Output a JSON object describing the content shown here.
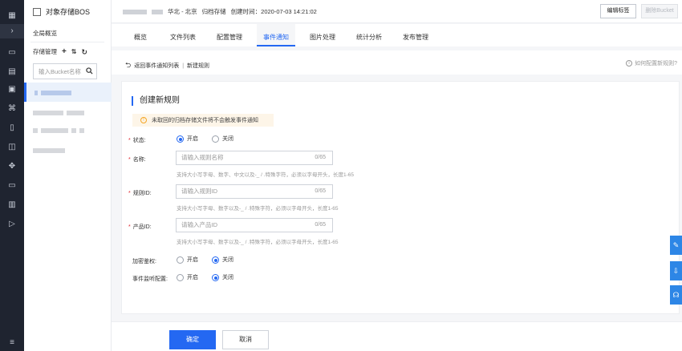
{
  "sidebar": {
    "title": "对象存储BOS",
    "overview": "全局概览",
    "store_mgr": "存储管理",
    "add_glyph": "+",
    "sort_glyph": "⇅",
    "refresh_glyph": "↻",
    "search_placeholder": "输入Bucket名称"
  },
  "header": {
    "region": "华北 - 北京",
    "storage_class": "归档存储",
    "created": "创建时间：2020-07-03 14:21:02",
    "edit_tag": "编辑标签",
    "delete_bucket": "删除Bucket"
  },
  "tabs": [
    "概览",
    "文件列表",
    "配置管理",
    "事件通知",
    "图片处理",
    "统计分析",
    "发布管理"
  ],
  "subbar": {
    "back": "返回事件通知列表",
    "new_rule": "新建规则",
    "help": "如何配置新规则?"
  },
  "form": {
    "title": "创建新规则",
    "tip": "未取回的归档存储文件将不会触发事件通知",
    "status_label": "状态:",
    "on": "开启",
    "off": "关闭",
    "name_label": "名称:",
    "name_placeholder": "请输入规则名称",
    "name_count": "0/65",
    "name_hint": "支持大小写字母、数字、中文以及-_ / .特殊字符，必须以字母开头，长度1-65",
    "ruleid_label": "规则ID:",
    "ruleid_placeholder": "请输入规则ID",
    "ruleid_count": "0/65",
    "ruleid_hint": "支持大小写字母、数字以及-_ / .特殊字符，必须以字母开头，长度1-65",
    "productid_label": "产品ID:",
    "productid_placeholder": "请输入产品ID",
    "productid_count": "0/65",
    "productid_hint": "支持大小写字母、数字以及-_ / .特殊字符，必须以字母开头，长度1-65",
    "encrypt_label": "加密鉴权:",
    "listen_label": "事件监听配置:",
    "confirm": "确定",
    "cancel": "取消"
  }
}
